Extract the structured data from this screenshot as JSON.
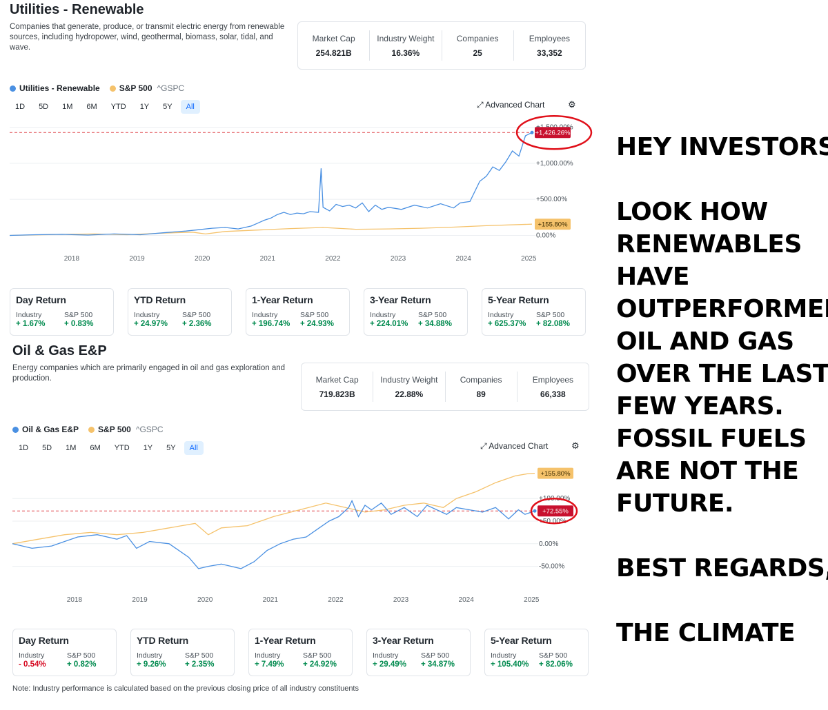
{
  "renewable": {
    "title": "Utilities - Renewable",
    "description": "Companies that generate, produce, or transmit electric energy from renewable sources, including hydropower, wind, geothermal, biomass, solar, tidal, and wave.",
    "stats": [
      {
        "label": "Market Cap",
        "value": "254.821B"
      },
      {
        "label": "Industry Weight",
        "value": "16.36%"
      },
      {
        "label": "Companies",
        "value": "25"
      },
      {
        "label": "Employees",
        "value": "33,352"
      }
    ],
    "legend_industry": "Utilities - Renewable",
    "legend_sp": "S&P 500",
    "legend_sp_symbol": "^GSPC",
    "ranges": [
      "1D",
      "5D",
      "1M",
      "6M",
      "YTD",
      "1Y",
      "5Y",
      "All"
    ],
    "active_range": "All",
    "advanced_chart": "Advanced Chart",
    "returns": [
      {
        "title": "Day Return",
        "industry_label": "Industry",
        "sp_label": "S&P 500",
        "industry": "+ 1.67%",
        "sp": "+ 0.83%"
      },
      {
        "title": "YTD Return",
        "industry_label": "Industry",
        "sp_label": "S&P 500",
        "industry": "+ 24.97%",
        "sp": "+ 2.36%"
      },
      {
        "title": "1-Year Return",
        "industry_label": "Industry",
        "sp_label": "S&P 500",
        "industry": "+ 196.74%",
        "sp": "+ 24.93%"
      },
      {
        "title": "3-Year Return",
        "industry_label": "Industry",
        "sp_label": "S&P 500",
        "industry": "+ 224.01%",
        "sp": "+ 34.88%"
      },
      {
        "title": "5-Year Return",
        "industry_label": "Industry",
        "sp_label": "S&P 500",
        "industry": "+ 625.37%",
        "sp": "+ 82.08%"
      }
    ]
  },
  "oilgas": {
    "title": "Oil & Gas E&P",
    "description": "Energy companies which are primarily engaged in oil and gas exploration and production.",
    "stats": [
      {
        "label": "Market Cap",
        "value": "719.823B"
      },
      {
        "label": "Industry Weight",
        "value": "22.88%"
      },
      {
        "label": "Companies",
        "value": "89"
      },
      {
        "label": "Employees",
        "value": "66,338"
      }
    ],
    "legend_industry": "Oil & Gas E&P",
    "legend_sp": "S&P 500",
    "legend_sp_symbol": "^GSPC",
    "ranges": [
      "1D",
      "5D",
      "1M",
      "6M",
      "YTD",
      "1Y",
      "5Y",
      "All"
    ],
    "active_range": "All",
    "advanced_chart": "Advanced Chart",
    "returns": [
      {
        "title": "Day Return",
        "industry_label": "Industry",
        "sp_label": "S&P 500",
        "industry": "- 0.54%",
        "sp": "+ 0.82%",
        "industry_negative": true
      },
      {
        "title": "YTD Return",
        "industry_label": "Industry",
        "sp_label": "S&P 500",
        "industry": "+ 9.26%",
        "sp": "+ 2.35%"
      },
      {
        "title": "1-Year Return",
        "industry_label": "Industry",
        "sp_label": "S&P 500",
        "industry": "+ 7.49%",
        "sp": "+ 24.92%"
      },
      {
        "title": "3-Year Return",
        "industry_label": "Industry",
        "sp_label": "S&P 500",
        "industry": "+ 29.49%",
        "sp": "+ 34.87%"
      },
      {
        "title": "5-Year Return",
        "industry_label": "Industry",
        "sp_label": "S&P 500",
        "industry": "+ 105.40%",
        "sp": "+ 82.06%"
      }
    ]
  },
  "note": "Note: Industry performance is calculated based on the previous closing price of all industry constituents",
  "meme_lines": [
    "HEY INVESTORS,",
    "",
    "LOOK HOW",
    "RENEWABLES",
    "HAVE",
    "OUTPERFORMED",
    "OIL AND GAS",
    "OVER THE LAST",
    "FEW YEARS.",
    "FOSSIL FUELS",
    "ARE NOT THE",
    "FUTURE.",
    "",
    "BEST REGARDS,",
    "",
    "THE CLIMATE"
  ],
  "colors": {
    "industry": "#4a90e2",
    "sp500": "#f5c26b",
    "last_value": "#c8102e",
    "annotation_circle": "#e0101a"
  },
  "chart_data": [
    {
      "type": "line",
      "years": [
        "2018",
        "2019",
        "2020",
        "2021",
        "2022",
        "2023",
        "2024",
        "2025"
      ],
      "y_ticks": [
        "+1,500.00%",
        "+1,000.00%",
        "+500.00%",
        "0.00%"
      ],
      "ylim": [
        -100,
        1600
      ],
      "last_industry_label": "+1,426.26%",
      "last_sp_label": "+155.80%",
      "series": [
        {
          "name": "Utilities - Renewable",
          "x": [
            2017.2,
            2017.6,
            2018.0,
            2018.4,
            2018.8,
            2019.2,
            2019.6,
            2019.9,
            2020.1,
            2020.3,
            2020.5,
            2020.7,
            2020.9,
            2021.0,
            2021.1,
            2021.2,
            2021.3,
            2021.4,
            2021.5,
            2021.6,
            2021.7,
            2021.8,
            2021.93,
            2021.97,
            2022.0,
            2022.1,
            2022.2,
            2022.3,
            2022.4,
            2022.5,
            2022.6,
            2022.7,
            2022.8,
            2022.9,
            2023.0,
            2023.2,
            2023.4,
            2023.6,
            2023.8,
            2024.0,
            2024.1,
            2024.25,
            2024.4,
            2024.5,
            2024.6,
            2024.7,
            2024.8,
            2024.9,
            2025.0,
            2025.1,
            2025.2
          ],
          "values": [
            0,
            10,
            15,
            5,
            20,
            10,
            40,
            60,
            80,
            100,
            110,
            90,
            130,
            170,
            210,
            240,
            290,
            320,
            290,
            310,
            300,
            330,
            320,
            930,
            390,
            340,
            430,
            400,
            420,
            380,
            450,
            330,
            420,
            360,
            390,
            360,
            420,
            380,
            440,
            380,
            450,
            470,
            750,
            820,
            950,
            900,
            1020,
            1170,
            1100,
            1380,
            1426
          ]
        },
        {
          "name": "S&P 500",
          "x": [
            2017.2,
            2018.0,
            2018.5,
            2019.0,
            2019.5,
            2020.0,
            2020.2,
            2020.5,
            2021.0,
            2021.5,
            2022.0,
            2022.5,
            2023.0,
            2023.5,
            2024.0,
            2024.5,
            2025.0,
            2025.2
          ],
          "values": [
            0,
            15,
            20,
            10,
            30,
            45,
            20,
            55,
            75,
            95,
            110,
            85,
            90,
            100,
            115,
            135,
            150,
            155.8
          ]
        }
      ]
    },
    {
      "type": "line",
      "years": [
        "2018",
        "2019",
        "2020",
        "2021",
        "2022",
        "2023",
        "2024",
        "2025"
      ],
      "y_ticks": [
        "+100.00%",
        "+50.00%",
        "0.00%",
        "-50.00%"
      ],
      "ylim": [
        -75,
        175
      ],
      "last_industry_label": "+72.55%",
      "last_sp_label": "+155.80%",
      "series": [
        {
          "name": "Oil & Gas E&P",
          "x": [
            2017.2,
            2017.5,
            2017.8,
            2018.0,
            2018.2,
            2018.5,
            2018.8,
            2018.95,
            2019.1,
            2019.3,
            2019.6,
            2019.9,
            2020.05,
            2020.2,
            2020.4,
            2020.7,
            2020.9,
            2021.1,
            2021.3,
            2021.5,
            2021.7,
            2021.9,
            2022.05,
            2022.2,
            2022.35,
            2022.4,
            2022.5,
            2022.6,
            2022.7,
            2022.85,
            2023.0,
            2023.2,
            2023.4,
            2023.55,
            2023.7,
            2023.85,
            2024.0,
            2024.2,
            2024.4,
            2024.6,
            2024.8,
            2024.95,
            2025.05,
            2025.2
          ],
          "values": [
            0,
            -10,
            -5,
            5,
            15,
            20,
            10,
            18,
            -10,
            5,
            0,
            -30,
            -55,
            -50,
            -45,
            -55,
            -40,
            -15,
            0,
            10,
            15,
            35,
            50,
            60,
            80,
            95,
            60,
            85,
            75,
            90,
            65,
            80,
            60,
            85,
            75,
            65,
            80,
            75,
            70,
            80,
            55,
            75,
            65,
            72.55
          ]
        },
        {
          "name": "S&P 500",
          "x": [
            2017.2,
            2017.6,
            2018.0,
            2018.4,
            2018.8,
            2019.2,
            2019.6,
            2020.0,
            2020.2,
            2020.4,
            2020.8,
            2021.2,
            2021.6,
            2022.0,
            2022.3,
            2022.6,
            2022.9,
            2023.2,
            2023.5,
            2023.8,
            2024.0,
            2024.3,
            2024.6,
            2024.9,
            2025.1,
            2025.2
          ],
          "values": [
            0,
            10,
            20,
            25,
            20,
            25,
            35,
            45,
            20,
            35,
            40,
            60,
            75,
            90,
            80,
            70,
            75,
            85,
            90,
            80,
            100,
            115,
            135,
            150,
            155,
            155.8
          ]
        }
      ]
    }
  ]
}
